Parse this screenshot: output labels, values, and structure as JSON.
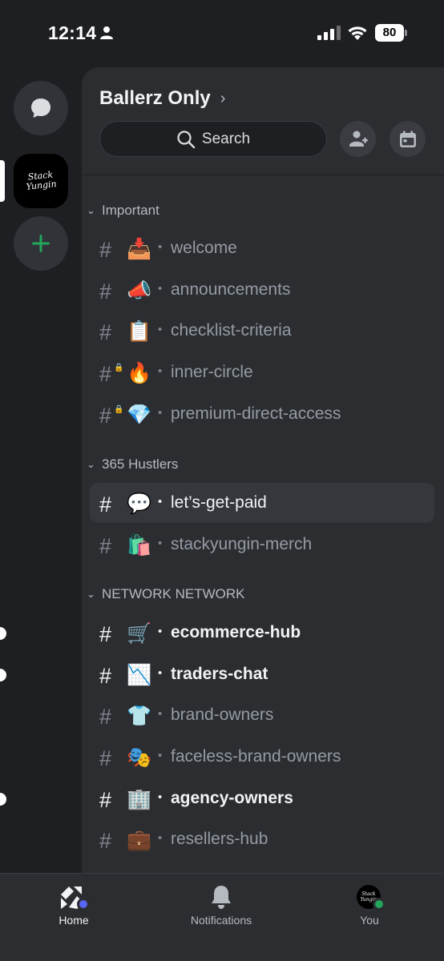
{
  "status_bar": {
    "time": "12:14",
    "battery": "80"
  },
  "server": {
    "name": "Ballerz Only",
    "logo_line1": "Stack",
    "logo_line2": "Yungin",
    "search_placeholder": "Search"
  },
  "categories": [
    {
      "name": "Important"
    },
    {
      "name": "365 Hustlers"
    },
    {
      "name": "NETWORK NETWORK"
    }
  ],
  "channels": [
    {
      "emoji": "📥",
      "name": "welcome"
    },
    {
      "emoji": "📣",
      "name": "announcements"
    },
    {
      "emoji": "📋",
      "name": "checklist-criteria"
    },
    {
      "emoji": "🔥",
      "name": "inner-circle"
    },
    {
      "emoji": "💎",
      "name": "premium-direct-access"
    },
    {
      "emoji": "💬",
      "name": "let’s-get-paid"
    },
    {
      "emoji": "🛍️",
      "name": "stackyungin-merch"
    },
    {
      "emoji": "🛒",
      "name": "ecommerce-hub"
    },
    {
      "emoji": "📉",
      "name": "traders-chat"
    },
    {
      "emoji": "👕",
      "name": "brand-owners"
    },
    {
      "emoji": "🎭",
      "name": "faceless-brand-owners"
    },
    {
      "emoji": "🏢",
      "name": "agency-owners"
    },
    {
      "emoji": "💼",
      "name": "resellers-hub"
    }
  ],
  "tabs": {
    "home": "Home",
    "notifications": "Notifications",
    "you": "You"
  },
  "colors": {
    "accent": "#5865f2",
    "online": "#23a55a",
    "add": "#23a55a"
  }
}
